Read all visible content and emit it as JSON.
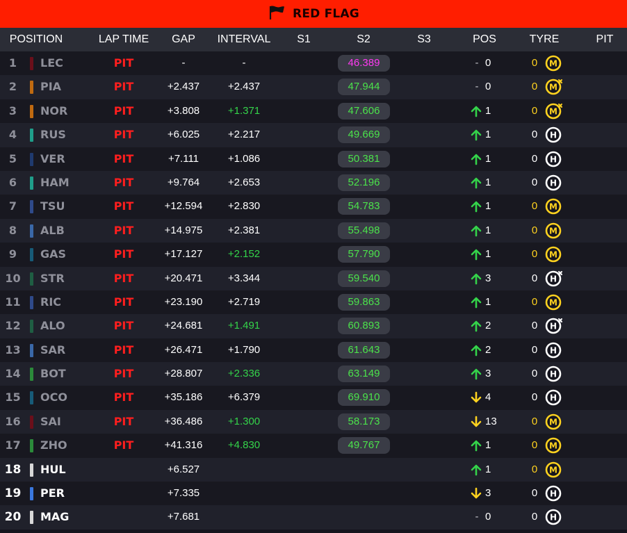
{
  "banner": {
    "title": "RED FLAG",
    "icon": "flag-icon"
  },
  "columns": {
    "position": "POSITION",
    "lap_time": "LAP TIME",
    "gap": "GAP",
    "interval": "INTERVAL",
    "s1": "S1",
    "s2": "S2",
    "s3": "S3",
    "pos": "POS",
    "tyre": "TYRE",
    "pit": "PIT"
  },
  "rows": [
    {
      "pos": "1",
      "team_color": "#6b0f1a",
      "driver": "LEC",
      "lap_time": "PIT",
      "gap": "-",
      "interval": "-",
      "interval_color": "white",
      "s2": "46.389",
      "s2_best": true,
      "pos_dir": "same",
      "pos_change": "0",
      "tyre_laps": "0",
      "tyre_laps_color": "yellow",
      "tyre": "M",
      "tyre_used": false,
      "active": false
    },
    {
      "pos": "2",
      "team_color": "#c06a10",
      "driver": "PIA",
      "lap_time": "PIT",
      "gap": "+2.437",
      "interval": "+2.437",
      "interval_color": "white",
      "s2": "47.944",
      "s2_best": false,
      "pos_dir": "same",
      "pos_change": "0",
      "tyre_laps": "0",
      "tyre_laps_color": "yellow",
      "tyre": "M",
      "tyre_used": true,
      "active": false
    },
    {
      "pos": "3",
      "team_color": "#c06a10",
      "driver": "NOR",
      "lap_time": "PIT",
      "gap": "+3.808",
      "interval": "+1.371",
      "interval_color": "green",
      "s2": "47.606",
      "s2_best": false,
      "pos_dir": "up",
      "pos_change": "1",
      "tyre_laps": "0",
      "tyre_laps_color": "yellow",
      "tyre": "M",
      "tyre_used": true,
      "active": false
    },
    {
      "pos": "4",
      "team_color": "#1f9e8a",
      "driver": "RUS",
      "lap_time": "PIT",
      "gap": "+6.025",
      "interval": "+2.217",
      "interval_color": "white",
      "s2": "49.669",
      "s2_best": false,
      "pos_dir": "up",
      "pos_change": "1",
      "tyre_laps": "0",
      "tyre_laps_color": "white",
      "tyre": "H",
      "tyre_used": false,
      "active": false
    },
    {
      "pos": "5",
      "team_color": "#1f3a6e",
      "driver": "VER",
      "lap_time": "PIT",
      "gap": "+7.111",
      "interval": "+1.086",
      "interval_color": "white",
      "s2": "50.381",
      "s2_best": false,
      "pos_dir": "up",
      "pos_change": "1",
      "tyre_laps": "0",
      "tyre_laps_color": "white",
      "tyre": "H",
      "tyre_used": false,
      "active": false
    },
    {
      "pos": "6",
      "team_color": "#1f9e8a",
      "driver": "HAM",
      "lap_time": "PIT",
      "gap": "+9.764",
      "interval": "+2.653",
      "interval_color": "white",
      "s2": "52.196",
      "s2_best": false,
      "pos_dir": "up",
      "pos_change": "1",
      "tyre_laps": "0",
      "tyre_laps_color": "white",
      "tyre": "H",
      "tyre_used": false,
      "active": false
    },
    {
      "pos": "7",
      "team_color": "#2f4a8a",
      "driver": "TSU",
      "lap_time": "PIT",
      "gap": "+12.594",
      "interval": "+2.830",
      "interval_color": "white",
      "s2": "54.783",
      "s2_best": false,
      "pos_dir": "up",
      "pos_change": "1",
      "tyre_laps": "0",
      "tyre_laps_color": "yellow",
      "tyre": "M",
      "tyre_used": false,
      "active": false
    },
    {
      "pos": "8",
      "team_color": "#3a68a8",
      "driver": "ALB",
      "lap_time": "PIT",
      "gap": "+14.975",
      "interval": "+2.381",
      "interval_color": "white",
      "s2": "55.498",
      "s2_best": false,
      "pos_dir": "up",
      "pos_change": "1",
      "tyre_laps": "0",
      "tyre_laps_color": "yellow",
      "tyre": "M",
      "tyre_used": false,
      "active": false
    },
    {
      "pos": "9",
      "team_color": "#175b78",
      "driver": "GAS",
      "lap_time": "PIT",
      "gap": "+17.127",
      "interval": "+2.152",
      "interval_color": "green",
      "s2": "57.790",
      "s2_best": false,
      "pos_dir": "up",
      "pos_change": "1",
      "tyre_laps": "0",
      "tyre_laps_color": "yellow",
      "tyre": "M",
      "tyre_used": false,
      "active": false
    },
    {
      "pos": "10",
      "team_color": "#1f5e43",
      "driver": "STR",
      "lap_time": "PIT",
      "gap": "+20.471",
      "interval": "+3.344",
      "interval_color": "white",
      "s2": "59.540",
      "s2_best": false,
      "pos_dir": "up",
      "pos_change": "3",
      "tyre_laps": "0",
      "tyre_laps_color": "white",
      "tyre": "H",
      "tyre_used": true,
      "active": false
    },
    {
      "pos": "11",
      "team_color": "#2f4a8a",
      "driver": "RIC",
      "lap_time": "PIT",
      "gap": "+23.190",
      "interval": "+2.719",
      "interval_color": "white",
      "s2": "59.863",
      "s2_best": false,
      "pos_dir": "up",
      "pos_change": "1",
      "tyre_laps": "0",
      "tyre_laps_color": "yellow",
      "tyre": "M",
      "tyre_used": false,
      "active": false
    },
    {
      "pos": "12",
      "team_color": "#1f5e43",
      "driver": "ALO",
      "lap_time": "PIT",
      "gap": "+24.681",
      "interval": "+1.491",
      "interval_color": "green",
      "s2": "60.893",
      "s2_best": false,
      "pos_dir": "up",
      "pos_change": "2",
      "tyre_laps": "0",
      "tyre_laps_color": "white",
      "tyre": "H",
      "tyre_used": true,
      "active": false
    },
    {
      "pos": "13",
      "team_color": "#3a68a8",
      "driver": "SAR",
      "lap_time": "PIT",
      "gap": "+26.471",
      "interval": "+1.790",
      "interval_color": "white",
      "s2": "61.643",
      "s2_best": false,
      "pos_dir": "up",
      "pos_change": "2",
      "tyre_laps": "0",
      "tyre_laps_color": "white",
      "tyre": "H",
      "tyre_used": false,
      "active": false
    },
    {
      "pos": "14",
      "team_color": "#2b8a3a",
      "driver": "BOT",
      "lap_time": "PIT",
      "gap": "+28.807",
      "interval": "+2.336",
      "interval_color": "green",
      "s2": "63.149",
      "s2_best": false,
      "pos_dir": "up",
      "pos_change": "3",
      "tyre_laps": "0",
      "tyre_laps_color": "white",
      "tyre": "H",
      "tyre_used": false,
      "active": false
    },
    {
      "pos": "15",
      "team_color": "#175b78",
      "driver": "OCO",
      "lap_time": "PIT",
      "gap": "+35.186",
      "interval": "+6.379",
      "interval_color": "white",
      "s2": "69.910",
      "s2_best": false,
      "pos_dir": "down",
      "pos_change": "4",
      "tyre_laps": "0",
      "tyre_laps_color": "white",
      "tyre": "H",
      "tyre_used": false,
      "active": false
    },
    {
      "pos": "16",
      "team_color": "#6b0f1a",
      "driver": "SAI",
      "lap_time": "PIT",
      "gap": "+36.486",
      "interval": "+1.300",
      "interval_color": "green",
      "s2": "58.173",
      "s2_best": false,
      "pos_dir": "down",
      "pos_change": "13",
      "tyre_laps": "0",
      "tyre_laps_color": "yellow",
      "tyre": "M",
      "tyre_used": false,
      "active": false
    },
    {
      "pos": "17",
      "team_color": "#2b8a3a",
      "driver": "ZHO",
      "lap_time": "PIT",
      "gap": "+41.316",
      "interval": "+4.830",
      "interval_color": "green",
      "s2": "49.767",
      "s2_best": false,
      "pos_dir": "up",
      "pos_change": "1",
      "tyre_laps": "0",
      "tyre_laps_color": "yellow",
      "tyre": "M",
      "tyre_used": false,
      "active": false
    },
    {
      "pos": "18",
      "team_color": "#d8d8d8",
      "driver": "HUL",
      "lap_time": "",
      "gap": "+6.527",
      "interval": "",
      "interval_color": "white",
      "s2": "",
      "s2_best": false,
      "pos_dir": "up",
      "pos_change": "1",
      "tyre_laps": "0",
      "tyre_laps_color": "yellow",
      "tyre": "M",
      "tyre_used": false,
      "active": true
    },
    {
      "pos": "19",
      "team_color": "#3a78e0",
      "driver": "PER",
      "lap_time": "",
      "gap": "+7.335",
      "interval": "",
      "interval_color": "white",
      "s2": "",
      "s2_best": false,
      "pos_dir": "down",
      "pos_change": "3",
      "tyre_laps": "0",
      "tyre_laps_color": "white",
      "tyre": "H",
      "tyre_used": false,
      "active": true
    },
    {
      "pos": "20",
      "team_color": "#d8d8d8",
      "driver": "MAG",
      "lap_time": "",
      "gap": "+7.681",
      "interval": "",
      "interval_color": "white",
      "s2": "",
      "s2_best": false,
      "pos_dir": "same",
      "pos_change": "0",
      "tyre_laps": "0",
      "tyre_laps_color": "white",
      "tyre": "H",
      "tyre_used": false,
      "active": true
    }
  ],
  "colors": {
    "banner": "#ff1e00",
    "header": "#2b2d36",
    "row_odd": "#181820",
    "row_even": "#20212b",
    "green": "#34d34a",
    "purple": "#ff3af2",
    "pit_red": "#ff1e1e",
    "yellow": "#ffd21f"
  }
}
